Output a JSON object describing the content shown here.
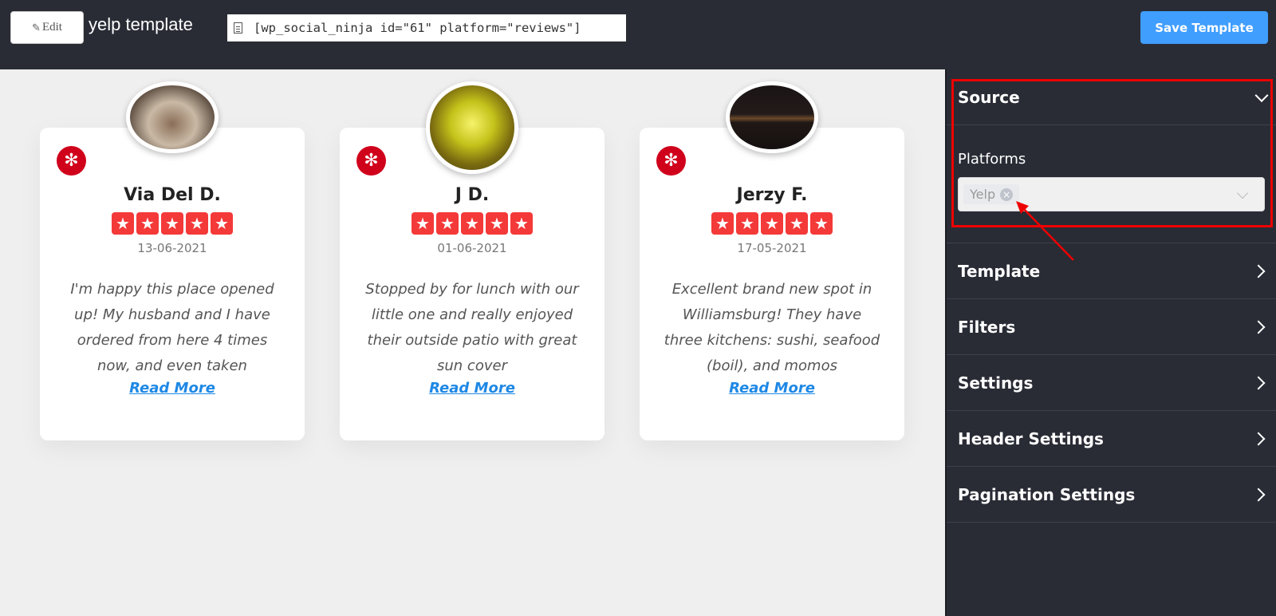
{
  "topbar": {
    "edit_label": "Edit",
    "edit_icon": "pencil-icon",
    "template_title": "yelp template",
    "shortcode": "[wp_social_ninja id=\"61\" platform=\"reviews\"]",
    "shortcode_icon": "document-icon",
    "save_label": "Save Template"
  },
  "reviews": [
    {
      "name": "Via Del D.",
      "rating": 5,
      "date": "13-06-2021",
      "text": "I'm happy this place opened up! My husband and I have ordered from here 4 times now, and even taken",
      "read_more": "Read More",
      "platform_icon": "yelp-logo-icon"
    },
    {
      "name": "J D.",
      "rating": 5,
      "date": "01-06-2021",
      "text": "Stopped by for lunch with our little one and really enjoyed their outside patio with great sun cover",
      "read_more": "Read More",
      "platform_icon": "yelp-logo-icon"
    },
    {
      "name": "Jerzy F.",
      "rating": 5,
      "date": "17-05-2021",
      "text": "Excellent brand new spot in Williamsburg! They have three kitchens: sushi, seafood (boil), and momos",
      "read_more": "Read More",
      "platform_icon": "yelp-logo-icon"
    }
  ],
  "sidebar": {
    "source": {
      "title": "Source",
      "expanded": true,
      "platforms_label": "Platforms",
      "selected_platforms": [
        "Yelp"
      ]
    },
    "panels": [
      {
        "label": "Template"
      },
      {
        "label": "Filters"
      },
      {
        "label": "Settings"
      },
      {
        "label": "Header Settings"
      },
      {
        "label": "Pagination Settings"
      }
    ]
  },
  "colors": {
    "accent": "#409eff",
    "star": "#f43939",
    "yelp": "#d0021b",
    "link": "#1e88e5",
    "annotation": "#ee0000",
    "sidebar_bg": "#292c35"
  }
}
